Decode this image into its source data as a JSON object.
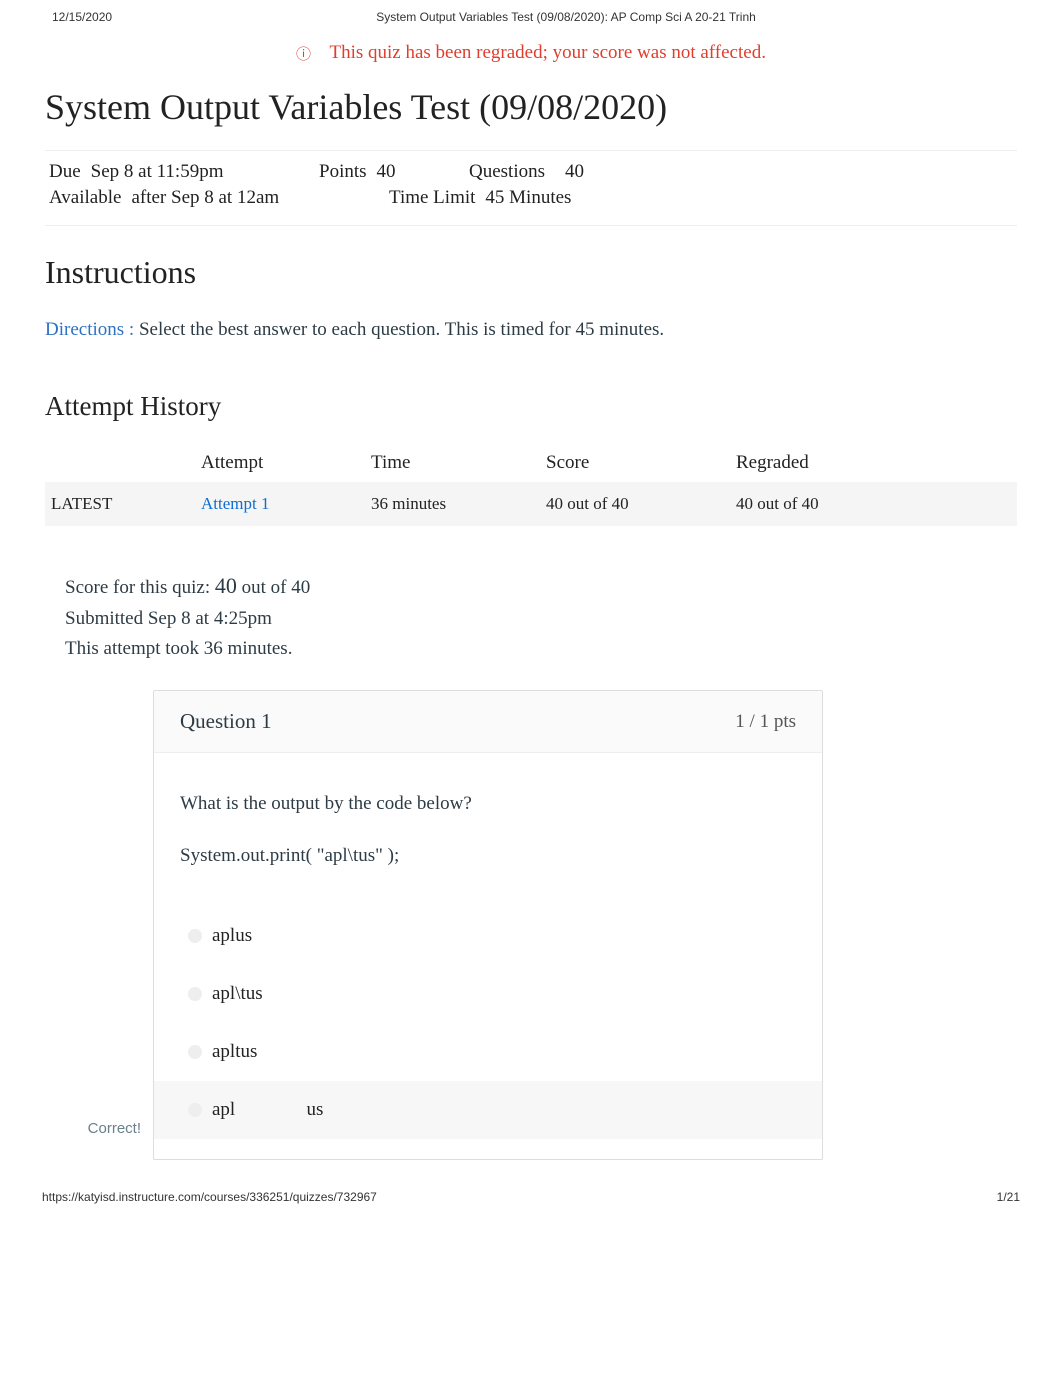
{
  "header": {
    "date": "12/15/2020",
    "doc_title": "System Output Variables Test (09/08/2020): AP Comp Sci A 20-21 Trinh"
  },
  "regrade_notice": "This quiz has been regraded; your score was not affected.",
  "quiz_title": "System Output Variables Test (09/08/2020)",
  "meta": {
    "due_label": "Due",
    "due_value": "Sep 8 at 11:59pm",
    "points_label": "Points",
    "points_value": "40",
    "questions_label": "Questions",
    "questions_value": "40",
    "available_label": "Available",
    "available_value": "after Sep 8 at 12am",
    "timelimit_label": "Time Limit",
    "timelimit_value": "45 Minutes"
  },
  "instructions": {
    "heading": "Instructions",
    "directions_label": "Directions :",
    "directions_text": "   Select the best answer to each question. This is timed for 45 minutes."
  },
  "attempt": {
    "heading": "Attempt History",
    "columns": {
      "c0": "",
      "c1": "Attempt",
      "c2": "Time",
      "c3": "Score",
      "c4": "Regraded"
    },
    "row": {
      "label": "LATEST",
      "attempt": "Attempt 1",
      "time": "36 minutes",
      "score": "40 out of 40",
      "regraded": "40 out of 40"
    }
  },
  "score_summary": {
    "line1_pre": "Score for this quiz: ",
    "score": "40",
    "line1_post": " out of 40",
    "line2": "Submitted Sep 8 at 4:25pm",
    "line3": "This attempt took 36 minutes."
  },
  "question": {
    "label": "Question 1",
    "points": "1 / 1 pts",
    "prompt1": "What is the output by the code below?",
    "prompt2": "System.out.print( \"apl\\tus\" );",
    "answers": {
      "a1": "aplus",
      "a2": "apl\\tus",
      "a3": "apltus",
      "a4": "apl               us"
    },
    "correct_label": "Correct!"
  },
  "footer": {
    "url": "https://katyisd.instructure.com/courses/336251/quizzes/732967",
    "page": "1/21"
  }
}
